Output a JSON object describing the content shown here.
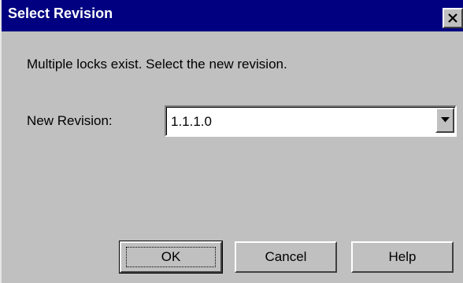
{
  "dialog": {
    "title": "Select Revision",
    "close_icon": "close-x-icon",
    "message": "Multiple locks exist.  Select the new revision.",
    "new_revision": {
      "label": "New Revision:",
      "selected_value": "1.1.1.0",
      "dropdown_icon": "chevron-down-icon"
    },
    "buttons": {
      "ok": "OK",
      "cancel": "Cancel",
      "help": "Help"
    }
  },
  "colors": {
    "titlebar": "#000080",
    "title_text": "#ffffff",
    "dialog_background": "#c0c0c0",
    "field_background": "#ffffff"
  }
}
